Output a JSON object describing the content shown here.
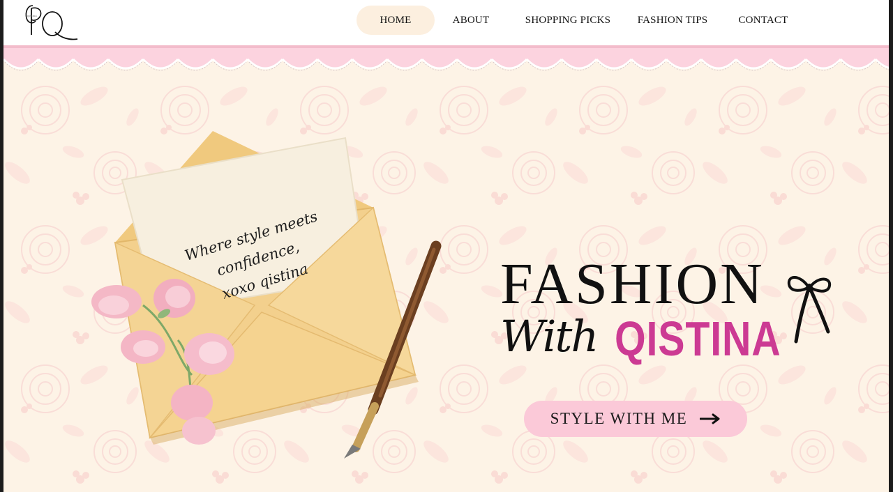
{
  "brand": {
    "logo_letters": "PQ",
    "logo_icon": "pq-monogram-icon"
  },
  "nav": {
    "items": [
      {
        "label": "HOME",
        "active": true
      },
      {
        "label": "ABOUT",
        "active": false
      },
      {
        "label": "SHOPPING PICKS",
        "active": false
      },
      {
        "label": "FASHION TIPS",
        "active": false
      },
      {
        "label": "CONTACT",
        "active": false
      }
    ]
  },
  "hero": {
    "note_lines": [
      "Where style meets",
      "confidence,",
      "xoxo qistina"
    ],
    "title": "FASHION",
    "with_text": "With",
    "name": "QISTINA",
    "cta_label": "STYLE WITH ME",
    "cta_icon": "arrow-right-icon",
    "decor_icons": [
      "ribbon-bow-icon",
      "envelope-illustration",
      "fountain-pen-icon",
      "sweet-pea-flowers"
    ]
  },
  "colors": {
    "accent_pink": "#cc3a93",
    "button_pink": "#fbc9d8",
    "band_pink": "#fcd3df",
    "background_cream": "#fdf3e6",
    "nav_active": "#fcefdf"
  }
}
